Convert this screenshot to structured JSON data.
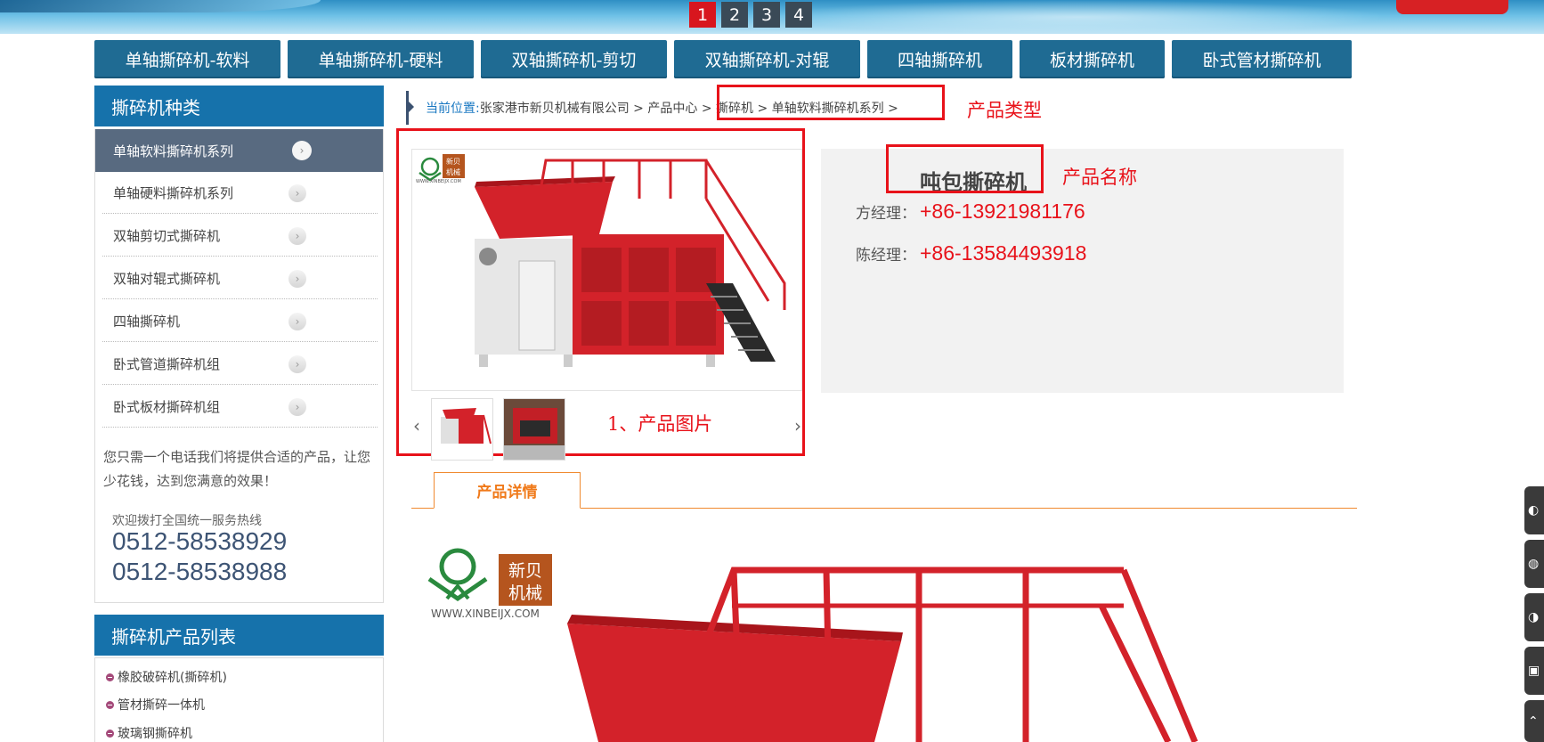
{
  "banner": {
    "pages": [
      "1",
      "2",
      "3",
      "4"
    ],
    "active_page": "1"
  },
  "topnav": {
    "items": [
      "单轴撕碎机-软料",
      "单轴撕碎机-硬料",
      "双轴撕碎机-剪切",
      "双轴撕碎机-对辊",
      "四轴撕碎机",
      "板材撕碎机",
      "卧式管材撕碎机"
    ]
  },
  "sidebar": {
    "title": "撕碎机种类",
    "items": [
      "单轴软料撕碎机系列",
      "单轴硬料撕碎机系列",
      "双轴剪切式撕碎机",
      "双轴对辊式撕碎机",
      "四轴撕碎机",
      "卧式管道撕碎机组",
      "卧式板材撕碎机组"
    ],
    "active_index": 0,
    "note": "您只需一个电话我们将提供合适的产品，让您少花钱，达到您满意的效果！",
    "hotline_label": "欢迎拨打全国统一服务热线",
    "hotline_1": "0512-58538929",
    "hotline_2": "0512-58538988",
    "list_title": "撕碎机产品列表",
    "list_items": [
      "橡胶破碎机(撕碎机)",
      "管材撕碎一体机",
      "玻璃钢撕碎机"
    ]
  },
  "breadcrumb": {
    "here_label": "当前位置:",
    "company": "张家港市新贝机械有限公司",
    "sep": ">",
    "center": "产品中心",
    "cat": "撕碎机",
    "series": "单轴软料撕碎机系列"
  },
  "annotations": {
    "type_label": "产品类型",
    "name_label": "产品名称",
    "image_label": "1、产品图片"
  },
  "product": {
    "name": "吨包撕碎机",
    "managers": [
      {
        "label": "方经理：",
        "phone": "+86-13921981176"
      },
      {
        "label": "陈经理：",
        "phone": "+86-13584493918"
      }
    ]
  },
  "gallery": {
    "prev": "‹",
    "next": "›"
  },
  "logo": {
    "cn_1": "新贝",
    "cn_2": "机械",
    "url": "WWW.XINBEIJX.COM"
  },
  "tabs": {
    "detail": "产品详情"
  },
  "colors": {
    "nav_blue": "#1f6b93",
    "header_blue": "#1672ab",
    "accent_red": "#e8121a",
    "tab_orange": "#f08a30",
    "machine_red": "#d3222a"
  }
}
